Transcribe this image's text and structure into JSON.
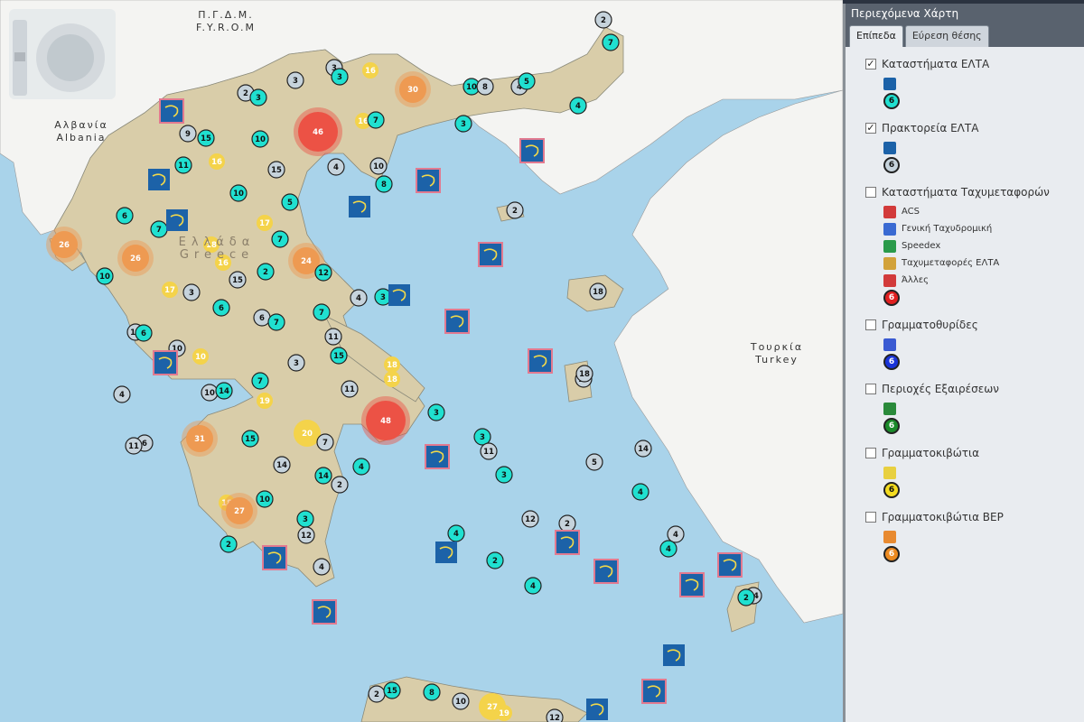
{
  "map": {
    "labels": {
      "fyrom_gr": "Π.Γ.Δ.Μ.",
      "fyrom_en": "F.Y.R.O.M",
      "albania_gr": "Αλβανία",
      "albania_en": "Albania",
      "greece_gr": "Ελλάδα",
      "greece_en": "Greece",
      "turkey_gr": "Τουρκία",
      "turkey_en": "Turkey"
    },
    "colors": {
      "sea": "#a9d3ea",
      "land_greece": "#d9cda9",
      "land_other": "#f4f4f2",
      "cluster_teal": "#20e0d0",
      "cluster_grey": "#c6d3dc",
      "cluster_yellow": "#f4d34a",
      "cluster_orange": "#ee9a52",
      "cluster_red": "#ec5245",
      "office_blue": "#1c62a8",
      "office_border": "#e27a90"
    },
    "clusters": [
      {
        "v": "2",
        "c": "grey"
      },
      {
        "v": "7",
        "c": "teal"
      },
      {
        "v": "3",
        "c": "grey"
      },
      {
        "v": "3",
        "c": "teal"
      },
      {
        "v": "16",
        "c": "yellow"
      },
      {
        "v": "30",
        "c": "orange"
      },
      {
        "v": "10",
        "c": "teal"
      },
      {
        "v": "8",
        "c": "grey"
      },
      {
        "v": "4",
        "c": "grey"
      },
      {
        "v": "5",
        "c": "teal"
      },
      {
        "v": "4",
        "c": "teal"
      },
      {
        "v": "2",
        "c": "grey"
      },
      {
        "v": "3",
        "c": "teal"
      },
      {
        "v": "3",
        "c": "grey"
      },
      {
        "v": "9",
        "c": "grey"
      },
      {
        "v": "15",
        "c": "teal"
      },
      {
        "v": "10",
        "c": "teal"
      },
      {
        "v": "46",
        "c": "red"
      },
      {
        "v": "16",
        "c": "yellow"
      },
      {
        "v": "7",
        "c": "teal"
      },
      {
        "v": "3",
        "c": "teal"
      },
      {
        "v": "11",
        "c": "teal"
      },
      {
        "v": "16",
        "c": "yellow"
      },
      {
        "v": "15",
        "c": "grey"
      },
      {
        "v": "4",
        "c": "grey"
      },
      {
        "v": "10",
        "c": "grey"
      },
      {
        "v": "8",
        "c": "teal"
      },
      {
        "v": "10",
        "c": "teal"
      },
      {
        "v": "5",
        "c": "teal"
      },
      {
        "v": "6",
        "c": "teal"
      },
      {
        "v": "2",
        "c": "grey"
      },
      {
        "v": "7",
        "c": "teal"
      },
      {
        "v": "17",
        "c": "yellow"
      },
      {
        "v": "26",
        "c": "orange"
      },
      {
        "v": "18",
        "c": "yellow"
      },
      {
        "v": "7",
        "c": "teal"
      },
      {
        "v": "26",
        "c": "orange"
      },
      {
        "v": "16",
        "c": "yellow"
      },
      {
        "v": "24",
        "c": "orange"
      },
      {
        "v": "2",
        "c": "teal"
      },
      {
        "v": "12",
        "c": "teal"
      },
      {
        "v": "18",
        "c": "grey"
      },
      {
        "v": "10",
        "c": "teal"
      },
      {
        "v": "15",
        "c": "grey"
      },
      {
        "v": "17",
        "c": "yellow"
      },
      {
        "v": "3",
        "c": "grey"
      },
      {
        "v": "4",
        "c": "grey"
      },
      {
        "v": "3",
        "c": "teal"
      },
      {
        "v": "6",
        "c": "teal"
      },
      {
        "v": "7",
        "c": "teal"
      },
      {
        "v": "6",
        "c": "grey"
      },
      {
        "v": "7",
        "c": "teal"
      },
      {
        "v": "10",
        "c": "grey"
      },
      {
        "v": "6",
        "c": "teal"
      },
      {
        "v": "10",
        "c": "grey"
      },
      {
        "v": "11",
        "c": "grey"
      },
      {
        "v": "10",
        "c": "yellow"
      },
      {
        "v": "3",
        "c": "grey"
      },
      {
        "v": "15",
        "c": "teal"
      },
      {
        "v": "18",
        "c": "yellow"
      },
      {
        "v": "18",
        "c": "yellow"
      },
      {
        "v": "11",
        "c": "grey"
      },
      {
        "v": "7",
        "c": "teal"
      },
      {
        "v": "4",
        "c": "grey"
      },
      {
        "v": "10",
        "c": "grey"
      },
      {
        "v": "14",
        "c": "teal"
      },
      {
        "v": "19",
        "c": "yellow"
      },
      {
        "v": "11",
        "c": "grey"
      },
      {
        "v": "48",
        "c": "red"
      },
      {
        "v": "3",
        "c": "teal"
      },
      {
        "v": "6",
        "c": "grey"
      },
      {
        "v": "31",
        "c": "orange"
      },
      {
        "v": "15",
        "c": "teal"
      },
      {
        "v": "20",
        "c": "yellow"
      },
      {
        "v": "7",
        "c": "grey"
      },
      {
        "v": "3",
        "c": "teal"
      },
      {
        "v": "11",
        "c": "grey"
      },
      {
        "v": "14",
        "c": "grey"
      },
      {
        "v": "14",
        "c": "teal"
      },
      {
        "v": "2",
        "c": "grey"
      },
      {
        "v": "4",
        "c": "teal"
      },
      {
        "v": "3",
        "c": "teal"
      },
      {
        "v": "5",
        "c": "grey"
      },
      {
        "v": "14",
        "c": "grey"
      },
      {
        "v": "18",
        "c": "yellow"
      },
      {
        "v": "27",
        "c": "orange"
      },
      {
        "v": "10",
        "c": "teal"
      },
      {
        "v": "3",
        "c": "teal"
      },
      {
        "v": "12",
        "c": "grey"
      },
      {
        "v": "4",
        "c": "teal"
      },
      {
        "v": "2",
        "c": "teal"
      },
      {
        "v": "4",
        "c": "grey"
      },
      {
        "v": "12",
        "c": "grey"
      },
      {
        "v": "2",
        "c": "grey"
      },
      {
        "v": "4",
        "c": "teal"
      },
      {
        "v": "2",
        "c": "teal"
      },
      {
        "v": "4",
        "c": "grey"
      },
      {
        "v": "4",
        "c": "teal"
      },
      {
        "v": "4",
        "c": "teal"
      },
      {
        "v": "14",
        "c": "grey"
      },
      {
        "v": "2",
        "c": "teal"
      },
      {
        "v": "18",
        "c": "grey"
      },
      {
        "v": "11",
        "c": "grey"
      },
      {
        "v": "2",
        "c": "grey"
      },
      {
        "v": "15",
        "c": "teal"
      },
      {
        "v": "8",
        "c": "teal"
      },
      {
        "v": "10",
        "c": "grey"
      },
      {
        "v": "27",
        "c": "yellow"
      },
      {
        "v": "19",
        "c": "yellow"
      },
      {
        "v": "12",
        "c": "grey"
      }
    ],
    "offices_count": 21
  },
  "panel": {
    "title": "Περιεχόμενα Χάρτη",
    "tabs": [
      {
        "label": "Επίπεδα",
        "active": true
      },
      {
        "label": "Εύρεση θέσης",
        "active": false
      }
    ],
    "layers": [
      {
        "name": "Καταστήματα ΕΛΤΑ",
        "checked": true,
        "legend": [
          {
            "icon": "elta-store-icon",
            "color": "#1c62a8",
            "label": ""
          }
        ],
        "count_color": "#20e0d0",
        "count": "6"
      },
      {
        "name": "Πρακτορεία ΕΛΤΑ",
        "checked": true,
        "legend": [
          {
            "icon": "elta-agency-icon",
            "color": "#1c62a8",
            "label": ""
          }
        ],
        "count_color": "#c6d3dc",
        "count": "6"
      },
      {
        "name": "Καταστήματα Ταχυμεταφορών",
        "checked": false,
        "legend": [
          {
            "icon": "acs-icon",
            "color": "#d23a3a",
            "label": "ACS"
          },
          {
            "icon": "geniki-icon",
            "color": "#3a6ad2",
            "label": "Γενική Ταχυδρομική"
          },
          {
            "icon": "speedex-icon",
            "color": "#2a9a4a",
            "label": "Speedex"
          },
          {
            "icon": "elta-courier-icon",
            "color": "#d2a23a",
            "label": "Ταχυμεταφορές ΕΛΤΑ"
          },
          {
            "icon": "other-courier-icon",
            "color": "#d23a3a",
            "label": "Άλλες"
          }
        ],
        "count_color": "#e02020",
        "count": "6"
      },
      {
        "name": "Γραμματοθυρίδες",
        "checked": false,
        "legend": [
          {
            "icon": "po-box-icon",
            "color": "#3a5ad2",
            "label": ""
          }
        ],
        "count_color": "#1a34d8",
        "count": "6"
      },
      {
        "name": "Περιοχές Εξαιρέσεων",
        "checked": false,
        "legend": [
          {
            "icon": "exception-area-icon",
            "color": "#2a8a3a",
            "label": ""
          }
        ],
        "count_color": "#1a8a2a",
        "count": "6"
      },
      {
        "name": "Γραμματοκιβώτια",
        "checked": false,
        "legend": [
          {
            "icon": "mailbox-icon",
            "color": "#e8d040",
            "label": ""
          }
        ],
        "count_color": "#f4dc20",
        "count": "6"
      },
      {
        "name": "Γραμματοκιβώτια ΒΕΡ",
        "checked": false,
        "legend": [
          {
            "icon": "mailbox-bep-icon",
            "color": "#e88a30",
            "label": ""
          }
        ],
        "count_color": "#ec8a20",
        "count": "6"
      }
    ]
  }
}
